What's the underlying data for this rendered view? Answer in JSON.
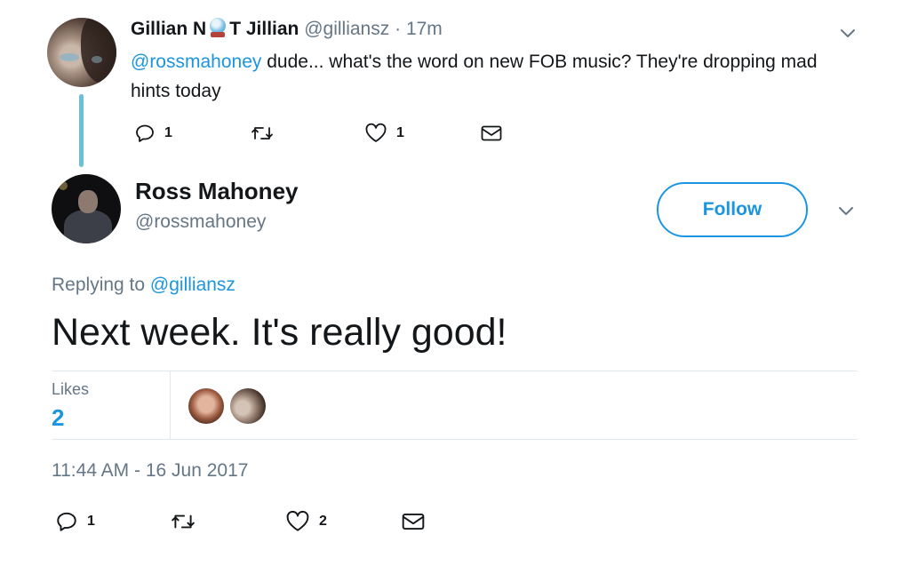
{
  "parent_tweet": {
    "name_part1": "Gillian N",
    "name_emoji": "crystal-ball-emoji",
    "name_part2": "T Jillian",
    "handle": "@gilliansz",
    "separator": "·",
    "time": "17m",
    "mention": "@rossmahoney",
    "text": " dude... what's the word on new FOB music? They're dropping mad hints today",
    "reply_count": "1",
    "like_count": "1"
  },
  "main_tweet": {
    "name": "Ross Mahoney",
    "handle": "@rossmahoney",
    "follow_label": "Follow",
    "replying_prefix": "Replying to ",
    "replying_to": "@gilliansz",
    "text": "Next week. It's really good!",
    "likes_label": "Likes",
    "likes_count": "2",
    "timestamp": "11:44 AM - 16 Jun 2017",
    "reply_count": "1",
    "like_count": "2"
  },
  "colors": {
    "accent": "#1b95e0",
    "muted": "#657786",
    "thread_line": "#6bbfd8",
    "divider": "#e1e8ed"
  },
  "icons": [
    "reply-icon",
    "retweet-icon",
    "like-icon",
    "direct-message-icon",
    "chevron-down-icon"
  ]
}
